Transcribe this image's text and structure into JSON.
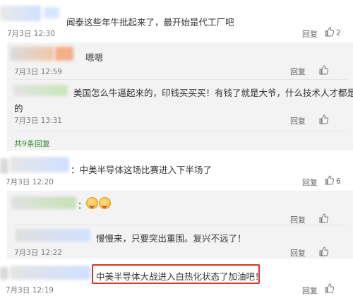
{
  "comments": [
    {
      "id": "c1",
      "text": "闻泰这些年牛批起来了，最开始是代工厂吧",
      "time": "7月3日 12:30",
      "reply": "回复",
      "likes": "2"
    },
    {
      "id": "c2",
      "text": "嗯嗯",
      "time": "7月3日 12:59",
      "reply": "回复",
      "likes": ""
    },
    {
      "id": "c3",
      "text_line1": "美国怎么牛逼起来的，印钱买买买！有钱了就是大爷，什么技术人才都是你",
      "text_line2": "的",
      "time": "7月3日 13:31",
      "reply": "回复",
      "likes": ""
    },
    {
      "id": "more",
      "text": "共9条回复"
    },
    {
      "id": "c4",
      "text": "：中美半导体这场比赛进入下半场了",
      "time": "7月3日 12:20",
      "reply": "回复",
      "likes": "6"
    },
    {
      "id": "c5",
      "text": "：",
      "time": "",
      "reply": "回复",
      "likes": ""
    },
    {
      "id": "c6",
      "text": "慢慢来，只要突出重围。复兴不远了！",
      "time": "7月3日 12:22",
      "reply": "回复",
      "likes": ""
    },
    {
      "id": "c7",
      "text": "中美半导体大战进入白热化状态了加油吧！",
      "time": "7月3日 12:19",
      "reply": "回复",
      "likes": ""
    }
  ],
  "colors": {
    "highlight": "#e0302a",
    "reply_link": "#3a8a3a",
    "sub_bg": "#f3f3f3"
  },
  "icons": {
    "like": "thumbs-up-icon",
    "emoji": "grinning-face-emoji"
  }
}
